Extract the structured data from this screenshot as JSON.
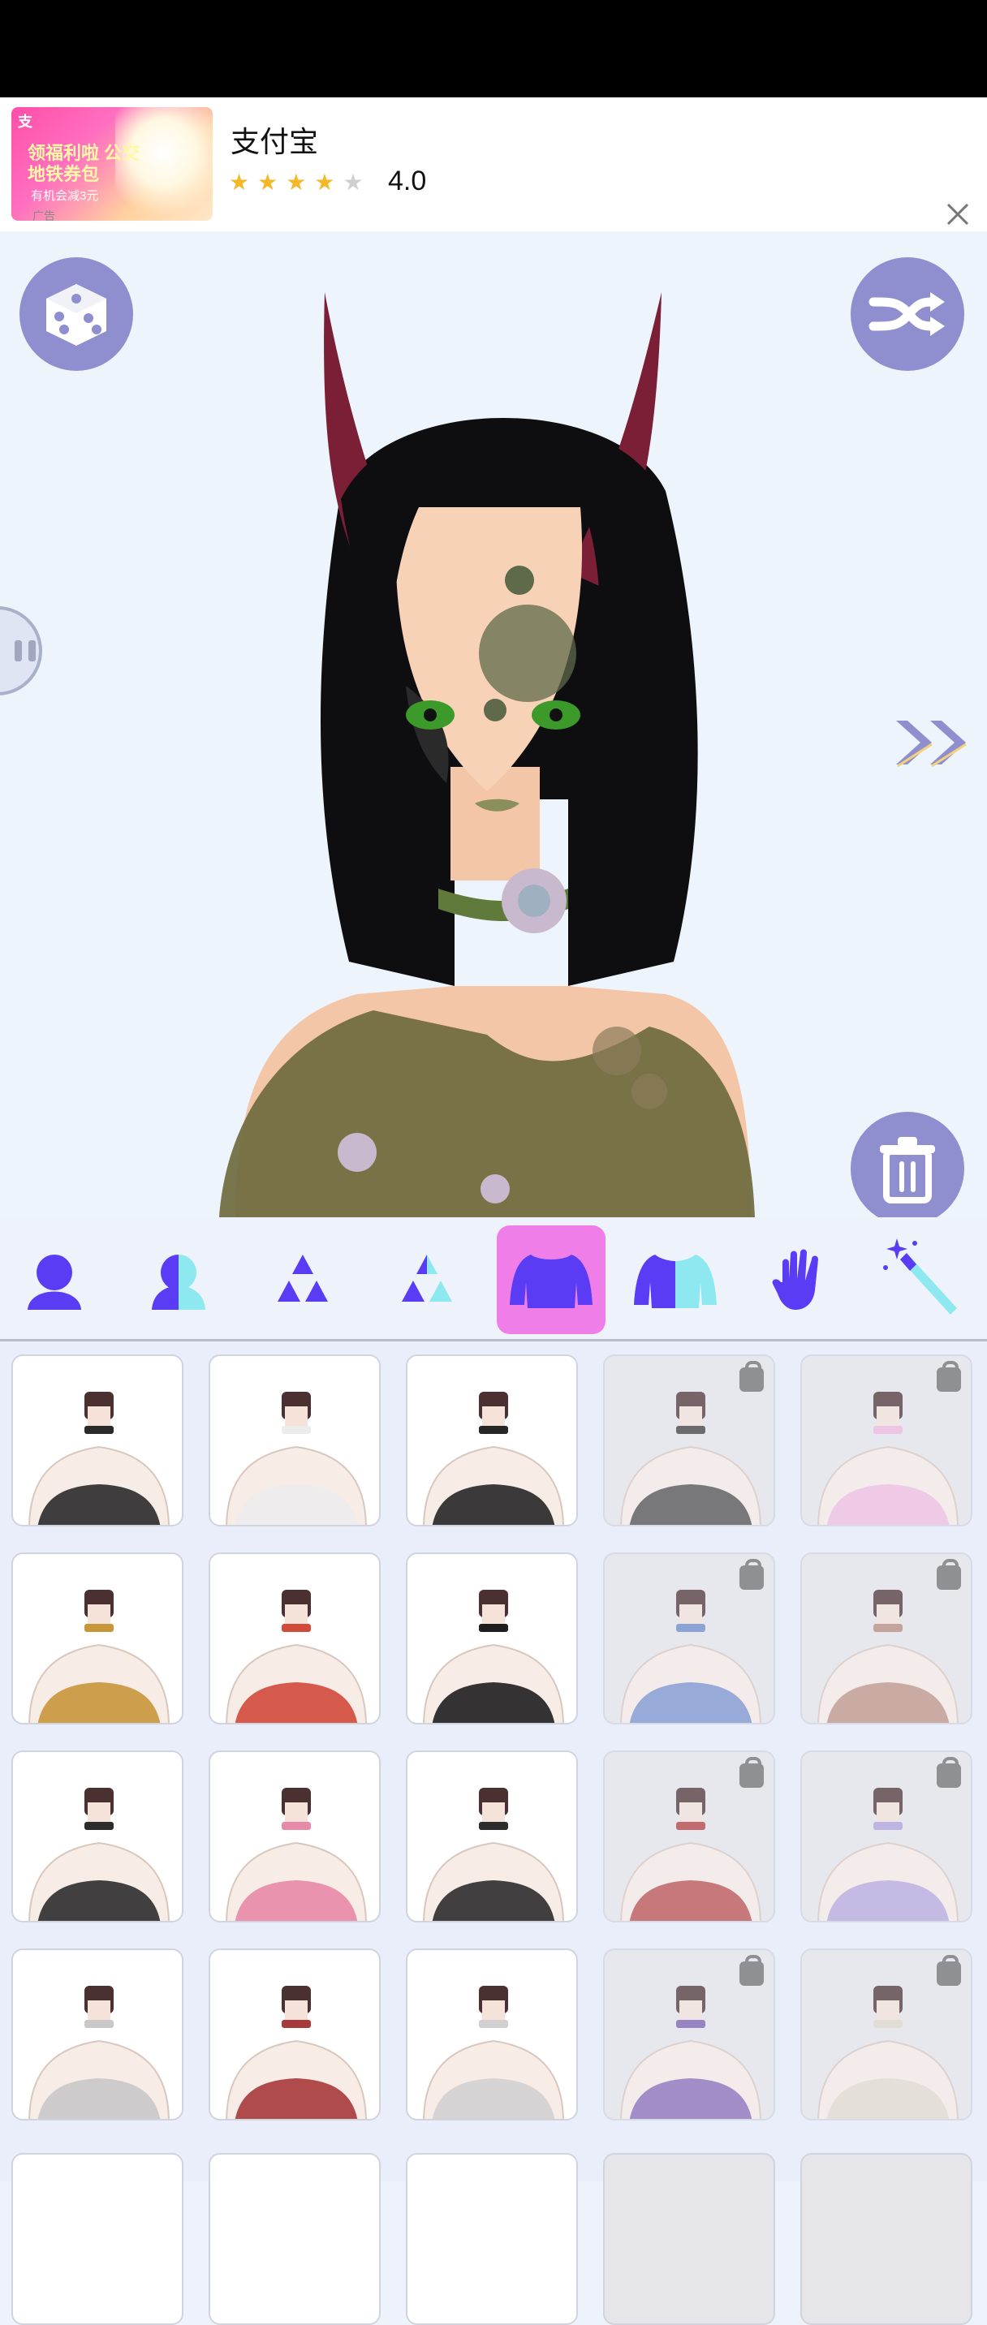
{
  "ad": {
    "app_name": "支付宝",
    "rating": "4.0",
    "stars_filled": 4,
    "stars_total": 5,
    "thumb_corner": "支",
    "thumb_headline": "领福利啦 公交地铁券包",
    "thumb_sub": "有机会减3元",
    "thumb_tag": "广告"
  },
  "canvas": {
    "top_left_button": "dice-icon",
    "top_right_button": "shuffle-icon",
    "bottom_right_button": "trash-icon",
    "left_tab": "pause-icon",
    "right_arrow": "double-chevron-right-icon"
  },
  "categories": [
    {
      "name": "body",
      "icon": "silhouette-icon",
      "active": false
    },
    {
      "name": "body-color",
      "icon": "silhouette-half-icon",
      "active": false
    },
    {
      "name": "features",
      "icon": "triangles-icon",
      "active": false
    },
    {
      "name": "features-color",
      "icon": "triangles-half-icon",
      "active": false
    },
    {
      "name": "tops",
      "icon": "sweater-icon",
      "active": true
    },
    {
      "name": "tops-color",
      "icon": "sweater-half-icon",
      "active": false
    },
    {
      "name": "hands",
      "icon": "hand-icon",
      "active": false
    },
    {
      "name": "effects",
      "icon": "magic-wand-icon",
      "active": false
    }
  ],
  "items": [
    {
      "style": "black-offshoulder",
      "locked": false
    },
    {
      "style": "white-wrap",
      "locked": false
    },
    {
      "style": "black-strap",
      "locked": false
    },
    {
      "style": "fur-collar",
      "locked": true
    },
    {
      "style": "pink-nurse",
      "locked": true
    },
    {
      "style": "egyptian-collar",
      "locked": false
    },
    {
      "style": "red-sash",
      "locked": false
    },
    {
      "style": "pentagram-harness",
      "locked": false
    },
    {
      "style": "blue-bow-lace",
      "locked": true
    },
    {
      "style": "plaid-red-bow",
      "locked": true
    },
    {
      "style": "black-tie-bikini",
      "locked": false
    },
    {
      "style": "pink-bow-halter",
      "locked": false
    },
    {
      "style": "spiked-harness",
      "locked": false
    },
    {
      "style": "ruffle-red-bows",
      "locked": true
    },
    {
      "style": "sailor-collar",
      "locked": true
    },
    {
      "style": "fishnet-top",
      "locked": false
    },
    {
      "style": "rose-bustier",
      "locked": false
    },
    {
      "style": "skeleton-top",
      "locked": false
    },
    {
      "style": "purple-halter",
      "locked": true
    },
    {
      "style": "cross-necklace-top",
      "locked": true
    }
  ],
  "colors": {
    "accent": "#5a3cf5",
    "accent_light": "#8ee8ef",
    "active_tab": "#ef7ee8",
    "round_button": "#8f8fcf",
    "star": "#f6b82b"
  }
}
